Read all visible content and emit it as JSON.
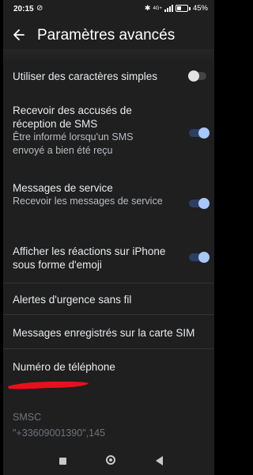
{
  "status_bar": {
    "time": "20:15",
    "network_label": "4G+",
    "battery": "45%",
    "battery_level": 0.45
  },
  "app_bar": {
    "title": "Paramètres avancés"
  },
  "settings": [
    {
      "title": "Utiliser des caractères simples",
      "toggle": false
    },
    {
      "title": "Recevoir des accusés de réception de SMS",
      "subtitle": "Être informé lorsqu'un SMS envoyé a bien été reçu",
      "toggle": true
    },
    {
      "title": "Messages de service",
      "subtitle": "Recevoir les messages de service",
      "toggle": true
    },
    {
      "title": "Afficher les réactions sur iPhone sous forme d'emoji",
      "toggle": true
    },
    {
      "title": "Alertes d'urgence sans fil"
    },
    {
      "title": "Messages enregistrés sur la carte SIM"
    },
    {
      "title": "Numéro de téléphone"
    }
  ],
  "smsc": {
    "label": "SMSC",
    "value": "\"+33609001390\",145"
  },
  "colors": {
    "toggle_on_thumb": "#a8c7fa",
    "toggle_on_track": "#2c3e63",
    "redaction": "#e8101a"
  }
}
